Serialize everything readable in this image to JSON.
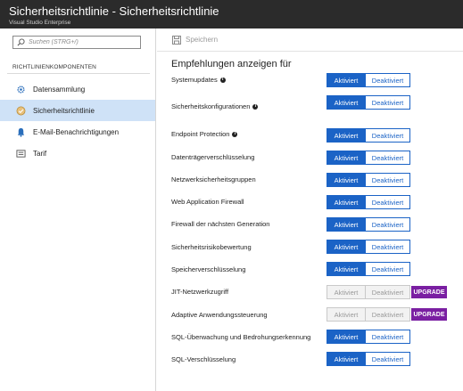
{
  "window": {
    "title": "Sicherheitsrichtlinie - Sicherheitsrichtlinie",
    "subtitle": "Visual Studio Enterprise"
  },
  "sidebar": {
    "search_placeholder": "Suchen (STRG+/)",
    "section_title": "RICHTLINIENKOMPONENTEN",
    "items": [
      {
        "label": "Datensammlung",
        "icon": "gear-icon",
        "active": false
      },
      {
        "label": "Sicherheitsrichtlinie",
        "icon": "policy-icon",
        "active": true
      },
      {
        "label": "E-Mail-Benachrichtigungen",
        "icon": "notification-icon",
        "active": false
      },
      {
        "label": "Tarif",
        "icon": "pricing-tier-icon",
        "active": false
      }
    ]
  },
  "toolbar": {
    "save_label": "Speichern",
    "save_icon": "save-icon"
  },
  "main": {
    "heading": "Empfehlungen anzeigen für",
    "on_label": "Aktiviert",
    "off_label": "Deaktiviert",
    "upgrade_label": "UPGRADE",
    "colors": {
      "accent": "#1b63c6",
      "upgrade": "#7a1fa2",
      "titlebar": "#2b2b2b",
      "active_nav": "#cfe2f7"
    },
    "rows": [
      {
        "label": "Systemupdates",
        "info": true,
        "state": "Aktiviert",
        "disabled": false
      },
      {
        "label": "Sicherheitskonfigurationen",
        "info": true,
        "state": "Aktiviert",
        "disabled": false
      },
      {
        "label": "Endpoint Protection",
        "info": true,
        "state": "Aktiviert",
        "disabled": false
      },
      {
        "label": "Datenträgerverschlüsselung",
        "info": false,
        "state": "Aktiviert",
        "disabled": false
      },
      {
        "label": "Netzwerksicherheitsgruppen",
        "info": false,
        "state": "Aktiviert",
        "disabled": false
      },
      {
        "label": "Web Application Firewall",
        "info": false,
        "state": "Aktiviert",
        "disabled": false
      },
      {
        "label": "Firewall der nächsten Generation",
        "info": false,
        "state": "Aktiviert",
        "disabled": false
      },
      {
        "label": "Sicherheitsrisikobewertung",
        "info": false,
        "state": "Aktiviert",
        "disabled": false
      },
      {
        "label": "Speicherverschlüsselung",
        "info": false,
        "state": "Aktiviert",
        "disabled": false
      },
      {
        "label": "JIT-Netzwerkzugriff",
        "info": false,
        "state": "none",
        "disabled": true,
        "upgrade": true
      },
      {
        "label": "Adaptive Anwendungssteuerung",
        "info": false,
        "state": "none",
        "disabled": true,
        "upgrade": true
      },
      {
        "label": "SQL-Überwachung und Bedrohungserkennung",
        "info": false,
        "state": "Aktiviert",
        "disabled": false
      },
      {
        "label": "SQL-Verschlüsselung",
        "info": false,
        "state": "Aktiviert",
        "disabled": false
      }
    ]
  }
}
